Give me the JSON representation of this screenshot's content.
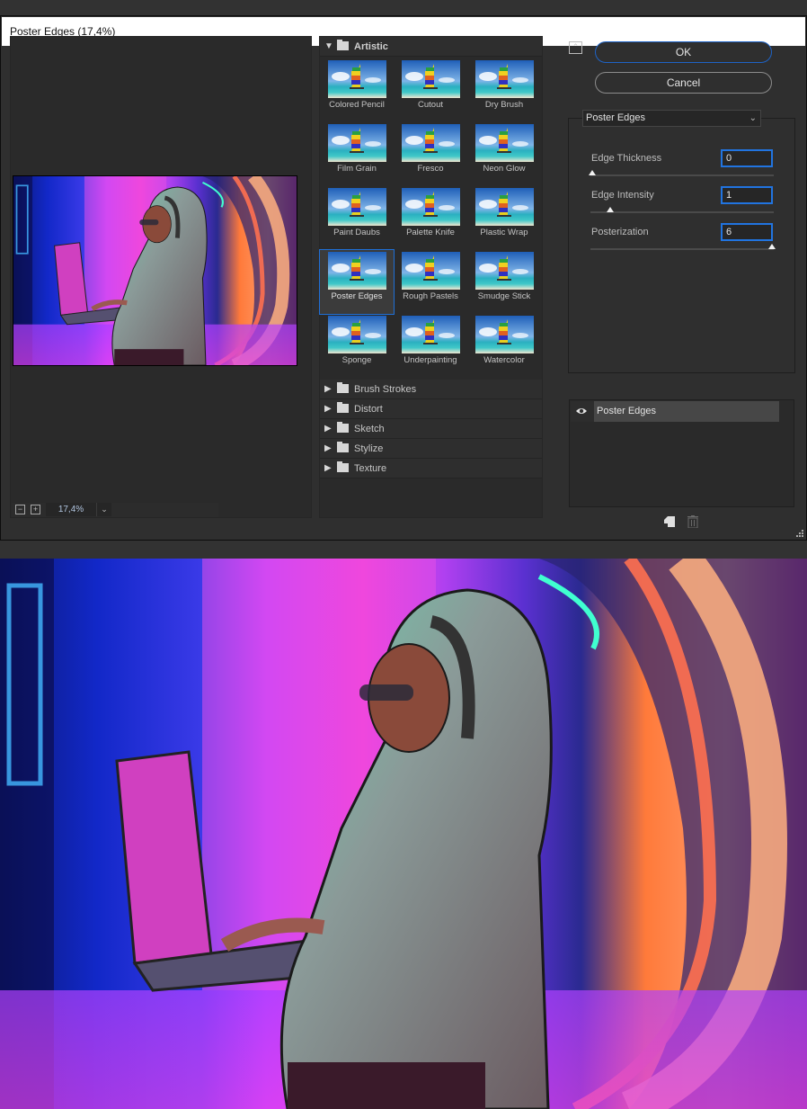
{
  "window": {
    "title": "Poster Edges (17,4%)"
  },
  "preview": {
    "zoom_value": "17,4%",
    "zoom_out_symbol": "−",
    "zoom_in_symbol": "+",
    "zoom_dropdown_symbol": "⌄",
    "image_description": "Woman in grey hoodie with headset using laptop in neon-lit room"
  },
  "gallery": {
    "open_category": {
      "label": "Artistic",
      "filters": [
        {
          "label": "Colored Pencil",
          "selected": false
        },
        {
          "label": "Cutout",
          "selected": false
        },
        {
          "label": "Dry Brush",
          "selected": false
        },
        {
          "label": "Film Grain",
          "selected": false
        },
        {
          "label": "Fresco",
          "selected": false
        },
        {
          "label": "Neon Glow",
          "selected": false
        },
        {
          "label": "Paint Daubs",
          "selected": false
        },
        {
          "label": "Palette Knife",
          "selected": false
        },
        {
          "label": "Plastic Wrap",
          "selected": false
        },
        {
          "label": "Poster Edges",
          "selected": true
        },
        {
          "label": "Rough Pastels",
          "selected": false
        },
        {
          "label": "Smudge Stick",
          "selected": false
        },
        {
          "label": "Sponge",
          "selected": false
        },
        {
          "label": "Underpainting",
          "selected": false
        },
        {
          "label": "Watercolor",
          "selected": false
        }
      ]
    },
    "closed_categories": [
      {
        "label": "Brush Strokes"
      },
      {
        "label": "Distort"
      },
      {
        "label": "Sketch"
      },
      {
        "label": "Stylize"
      },
      {
        "label": "Texture"
      }
    ]
  },
  "buttons": {
    "ok_label": "OK",
    "cancel_label": "Cancel"
  },
  "settings": {
    "filter_select_value": "Poster Edges",
    "params": [
      {
        "label": "Edge Thickness",
        "mnemonic": "E",
        "value": "0",
        "fraction": 0.0
      },
      {
        "label": "Edge Intensity",
        "mnemonic": "I",
        "value": "1",
        "fraction": 0.1
      },
      {
        "label": "Posterization",
        "mnemonic": "P",
        "value": "6",
        "fraction": 1.0
      }
    ]
  },
  "layers": {
    "items": [
      {
        "label": "Poster Edges",
        "visible": true
      }
    ]
  },
  "colors": {
    "accent_blue": "#1f6fd6",
    "dialog_bg": "#2f2f2f",
    "panel_bg": "#2a2a2a",
    "titlebar_bg": "#ffffff"
  }
}
